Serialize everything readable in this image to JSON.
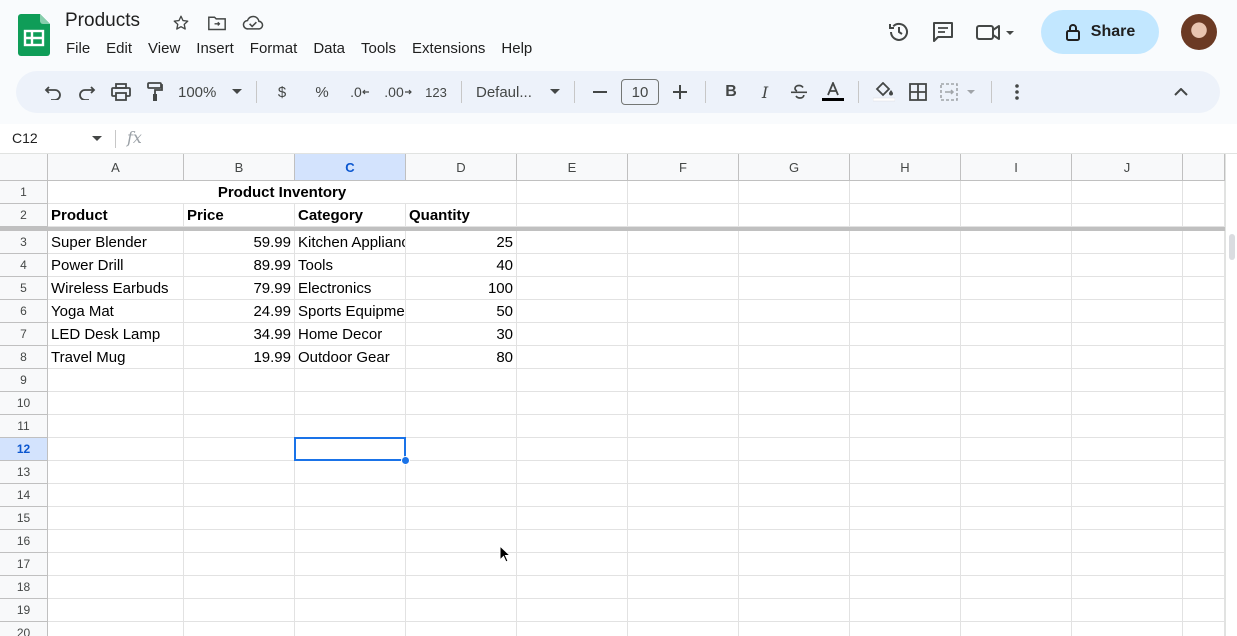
{
  "doc": {
    "title": "Products"
  },
  "menu": [
    "File",
    "Edit",
    "View",
    "Insert",
    "Format",
    "Data",
    "Tools",
    "Extensions",
    "Help"
  ],
  "share_label": "Share",
  "toolbar": {
    "zoom": "100%",
    "currency": "$",
    "percent": "%",
    "dec_decrease": ".0",
    "dec_increase": ".00",
    "number_format": "123",
    "font": "Defaul...",
    "font_size": "10",
    "bold": "B",
    "italic": "I"
  },
  "formula_bar": {
    "name_box": "C12",
    "fx": "fx",
    "value": ""
  },
  "columns": [
    "A",
    "B",
    "C",
    "D",
    "E",
    "F",
    "G",
    "H",
    "I",
    "J"
  ],
  "rows": [
    "1",
    "2",
    "3",
    "4",
    "5",
    "6",
    "7",
    "8",
    "9",
    "10",
    "11",
    "12",
    "13",
    "14",
    "15",
    "16",
    "17",
    "18",
    "19",
    "20"
  ],
  "sheet": {
    "title": "Product Inventory",
    "headers": [
      "Product",
      "Price",
      "Category",
      "Quantity"
    ],
    "data": [
      [
        "Super Blender",
        "59.99",
        "Kitchen Appliances",
        "25"
      ],
      [
        "Power Drill",
        "89.99",
        "Tools",
        "40"
      ],
      [
        "Wireless Earbuds",
        "79.99",
        "Electronics",
        "100"
      ],
      [
        "Yoga Mat",
        "24.99",
        "Sports Equipment",
        "50"
      ],
      [
        "LED Desk Lamp",
        "34.99",
        "Home Decor",
        "30"
      ],
      [
        "Travel Mug",
        "19.99",
        "Outdoor Gear",
        "80"
      ]
    ]
  },
  "selection": {
    "cell": "C12",
    "column": "C",
    "row": "12"
  },
  "colors": {
    "accent": "#1a73e8",
    "share_bg": "#c2e7ff",
    "header_bg": "#f8f9fa",
    "selected_header": "#d3e3fd"
  }
}
